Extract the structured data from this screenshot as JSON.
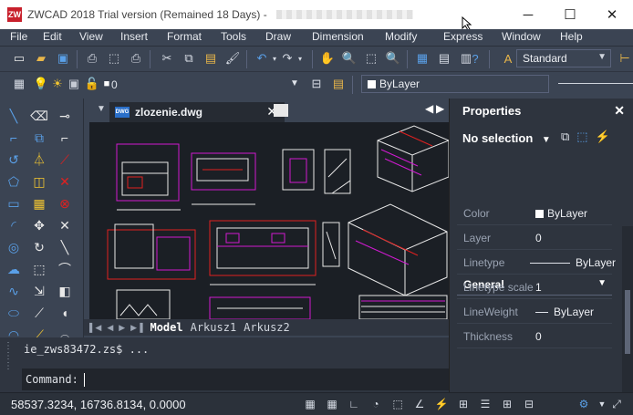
{
  "window": {
    "title": "ZWCAD 2018 Trial version (Remained 18 Days) -",
    "logo": "ZW",
    "minimize": "─",
    "maximize": "☐",
    "close": "✕"
  },
  "menu": [
    "File",
    "Edit",
    "View",
    "Insert",
    "Format",
    "Tools",
    "Draw",
    "Dimension",
    "Modify",
    "Express",
    "Window",
    "Help"
  ],
  "toolbar": {
    "text_style": "Standard",
    "layer_value": "0",
    "color_value": "ByLayer"
  },
  "document": {
    "tab_logo": "DWG",
    "tab_name": "zlozenie.dwg",
    "tab_close": "✕"
  },
  "layout_tabs": [
    "Model",
    "Arkusz1",
    "Arkusz2"
  ],
  "properties": {
    "title": "Properties",
    "close": "✕",
    "selection": "No selection",
    "group": "General",
    "rows": [
      {
        "label": "Color",
        "value": "ByLayer"
      },
      {
        "label": "Layer",
        "value": "0"
      },
      {
        "label": "Linetype",
        "value": "ByLayer"
      },
      {
        "label": "Linetype scale",
        "value": "1"
      },
      {
        "label": "LineWeight",
        "value": "ByLayer"
      },
      {
        "label": "Thickness",
        "value": "0"
      }
    ]
  },
  "command": {
    "history": "ie_zws83472.zs$ ...",
    "prompt": "Command:"
  },
  "status": {
    "coordinates": "58537.3234, 16736.8134, 0.0000"
  },
  "colors": {
    "ui_bg": "#3b4453",
    "canvas_bg": "#1b1f25",
    "accent_magenta": "#d01ad0",
    "accent_red": "#e02020",
    "accent_blue": "#2a6fc9"
  },
  "icons": {
    "draw_tools": [
      "line-icon",
      "eraser-icon",
      "polyline-icon",
      "copy-icon",
      "mirror-icon",
      "offset-icon",
      "array-icon",
      "move-icon",
      "rotate-icon",
      "scale-icon",
      "stretch-icon",
      "trim-icon",
      "extend-icon",
      "break-icon",
      "join-icon",
      "chamfer-icon",
      "fillet-icon",
      "explode-icon"
    ]
  }
}
